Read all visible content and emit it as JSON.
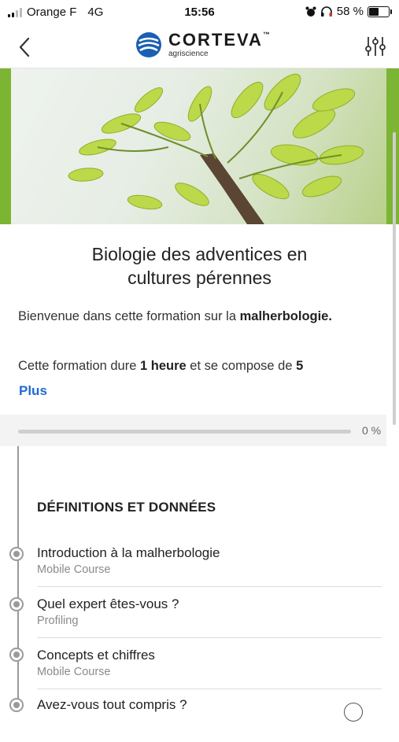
{
  "status_bar": {
    "carrier": "Orange F",
    "network": "4G",
    "time": "15:56",
    "battery": "58 %",
    "battery_level": 0.58
  },
  "header": {
    "logo_word": "CORTEVA",
    "logo_tm": "™",
    "logo_sub": "agriscience",
    "back_icon": "chevron-left-icon",
    "filter_icon": "sliders-icon"
  },
  "course": {
    "title_line1": "Biologie des adventices en",
    "title_line2": "cultures pérennes",
    "welcome_prefix": "Bienvenue dans cette formation sur la ",
    "welcome_bold": "malherbologie.",
    "duration_prefix": "Cette formation dure ",
    "duration_bold": "1 heure",
    "duration_mid": " et se compose de ",
    "duration_count": "5",
    "more_link": "Plus"
  },
  "progress": {
    "percent_label": "0 %",
    "value": 0
  },
  "section": {
    "title": "DÉFINITIONS ET DONNÉES",
    "items": [
      {
        "title": "Introduction à la malherbologie",
        "subtitle": "Mobile Course"
      },
      {
        "title": "Quel expert êtes-vous ?",
        "subtitle": "Profiling"
      },
      {
        "title": "Concepts et chiffres",
        "subtitle": "Mobile Course"
      },
      {
        "title": "Avez-vous tout compris ?",
        "subtitle": ""
      }
    ]
  },
  "colors": {
    "accent_green": "#7cb533",
    "link_blue": "#1e6bd4",
    "logo_blue": "#1a5fb4"
  }
}
